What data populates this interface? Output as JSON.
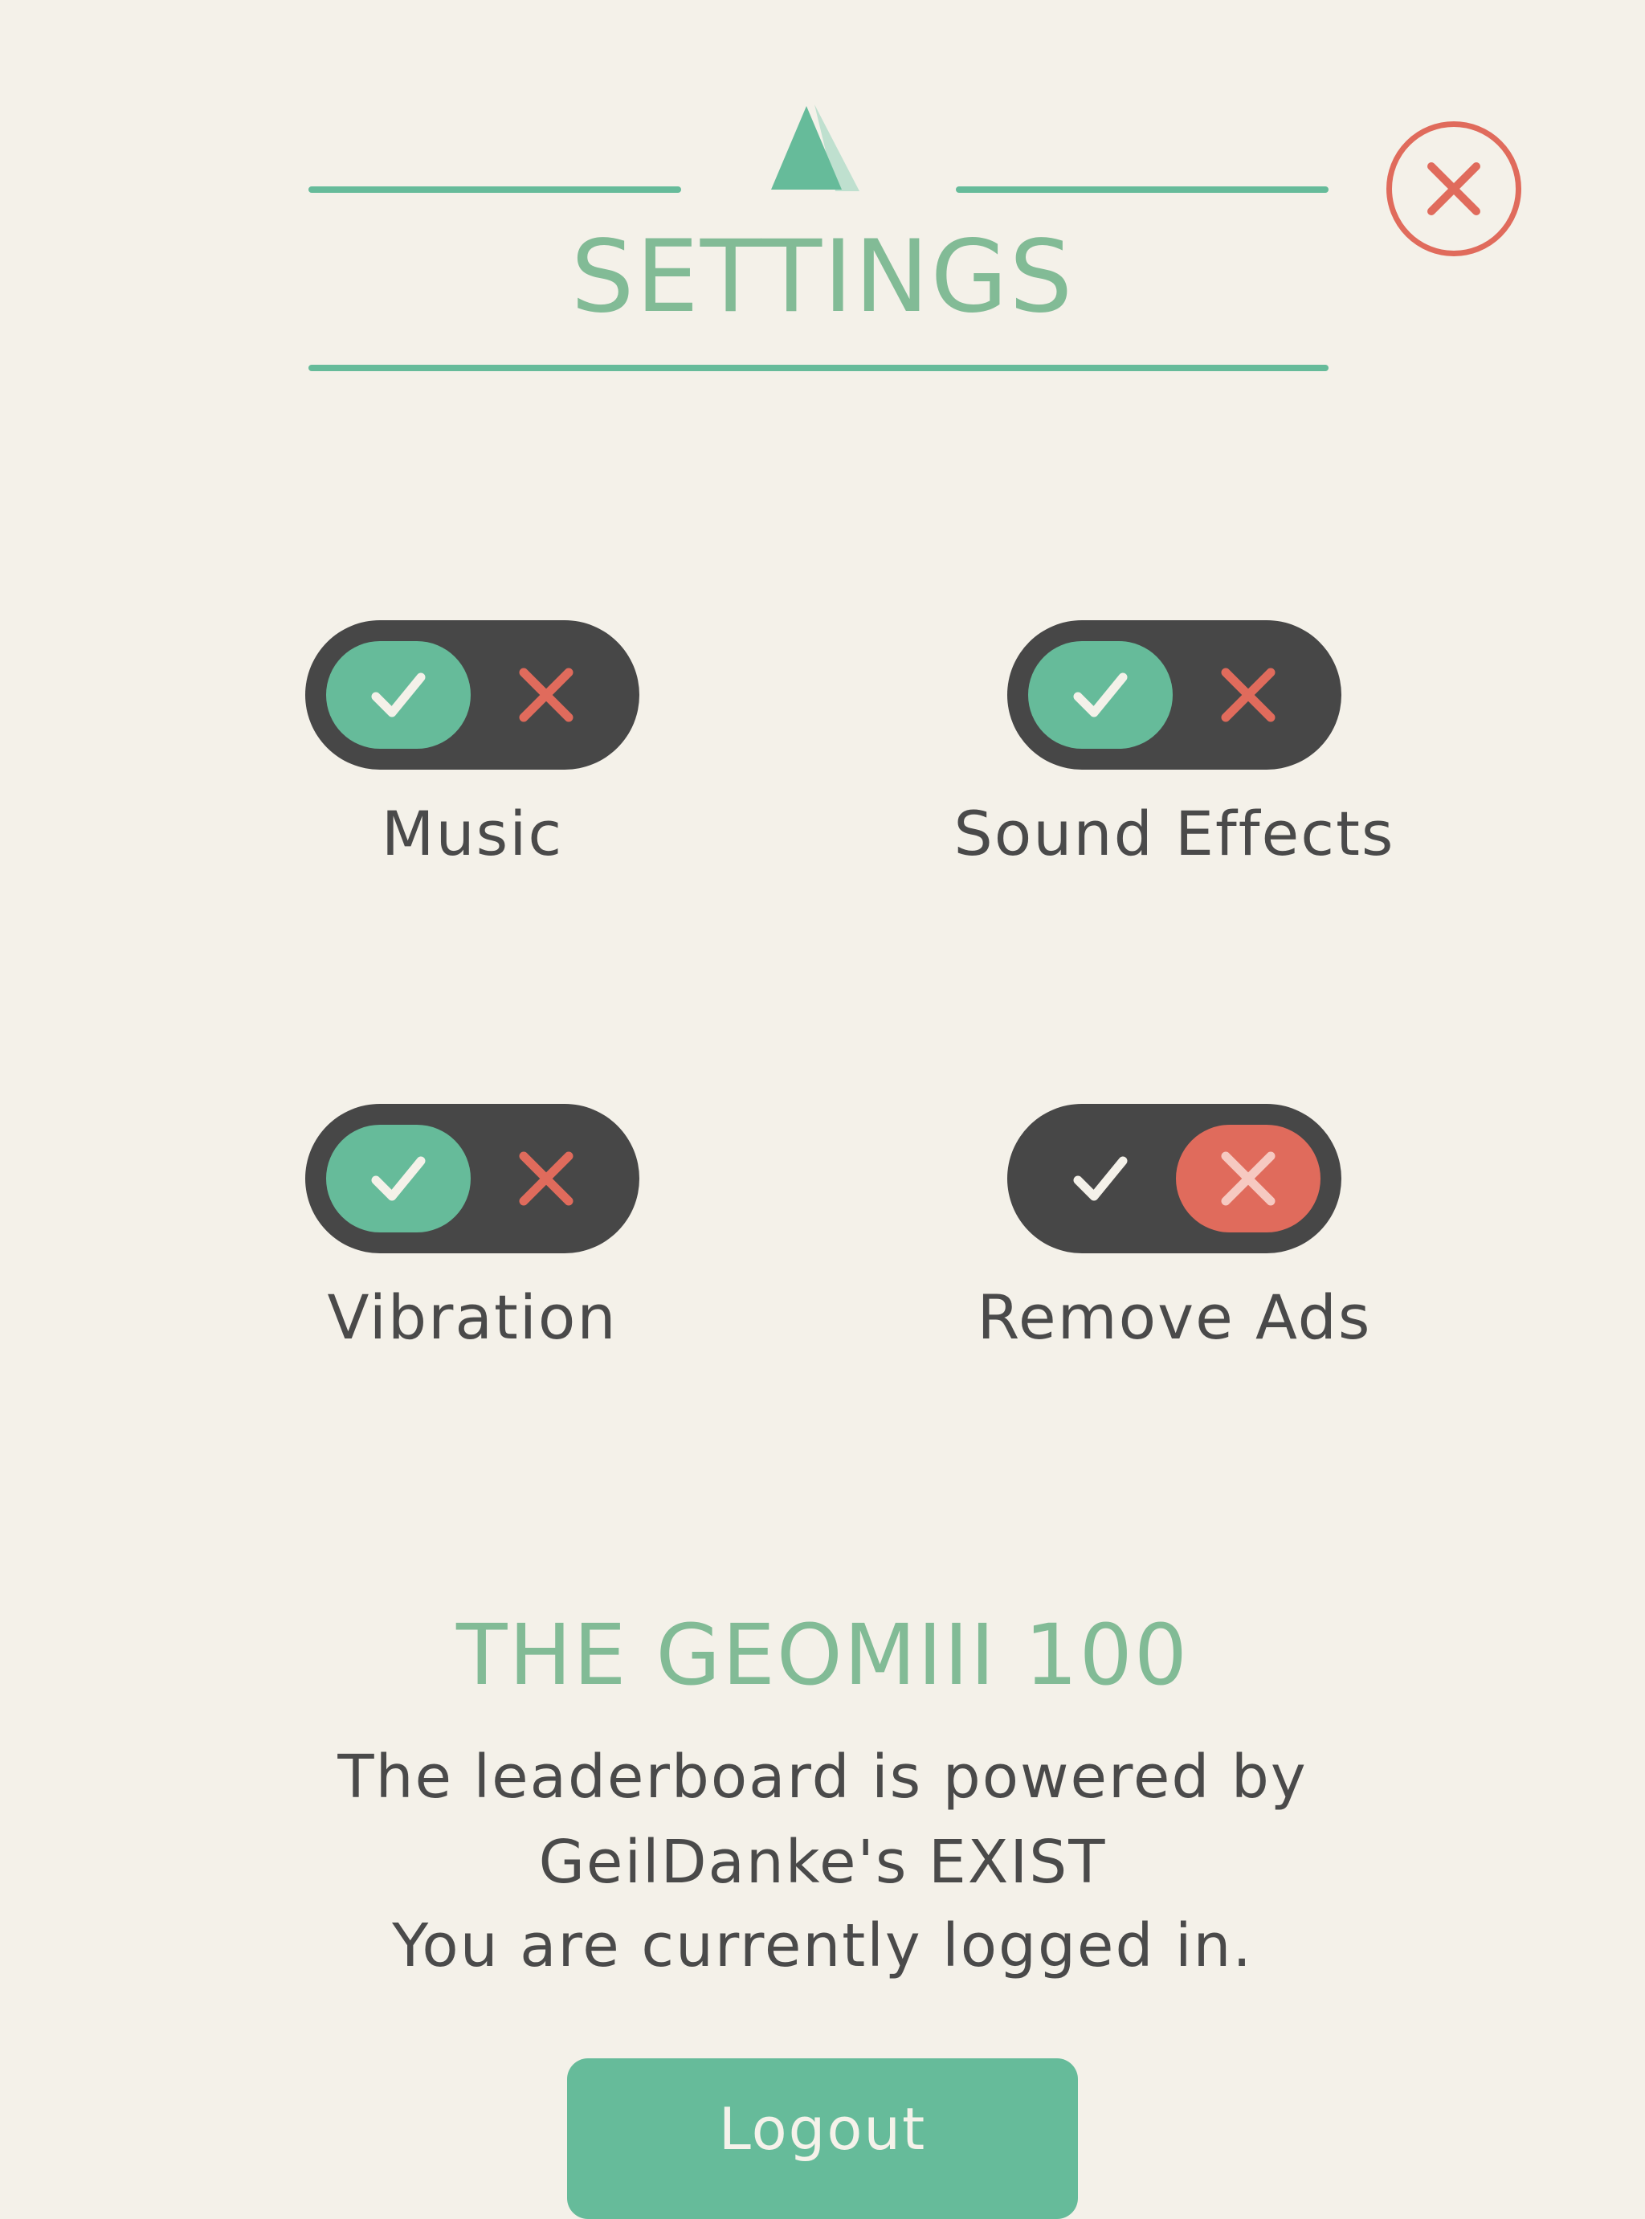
{
  "header": {
    "title": "SETTINGS",
    "logo_icon": "triangle-logo-icon",
    "close_icon": "close-x-icon"
  },
  "settings": {
    "items": [
      {
        "label": "Music",
        "state": "on"
      },
      {
        "label": "Sound Effects",
        "state": "on"
      },
      {
        "label": "Vibration",
        "state": "on"
      },
      {
        "label": "Remove Ads",
        "state": "off"
      }
    ]
  },
  "leaderboard": {
    "title": "THE GEOMIII 100",
    "lines": [
      "The leaderboard is powered by",
      "GeilDanke's EXIST",
      "You are currently logged in."
    ]
  },
  "logout": {
    "label": "Logout"
  },
  "colors": {
    "background": "#f4f1e9",
    "accent_green": "#66bb9a",
    "title_green": "#82bb96",
    "accent_red": "#e06b5c",
    "toggle_dark": "#474747",
    "text_dark": "#4a4a4a"
  }
}
